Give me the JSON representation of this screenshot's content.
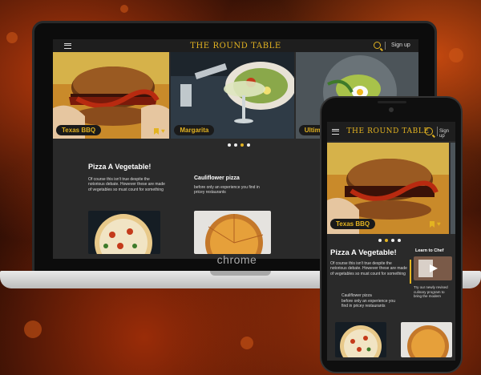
{
  "brand": "THE ROUND TABLE",
  "nav": {
    "signup": "Sign up"
  },
  "laptop": {
    "chrome_label": "chrome",
    "slides": [
      {
        "label": "Texas BBQ"
      },
      {
        "label": "Margarita"
      },
      {
        "label": "Ultim"
      }
    ],
    "article": {
      "title": "Pizza A Vegetable!",
      "body": "Of course this isn't true despite the notorious debate. However these are made of vegetables so must count for something"
    },
    "side": {
      "title": "Cauliflower pizza",
      "body": "before only an experience you find in pricey restaurants"
    }
  },
  "phone": {
    "slide_label": "Texas BBQ",
    "article": {
      "title": "Pizza A Vegetable!",
      "body": "Of course this isn't true despite the notorious debate. However these are made of vegetables so must count for something"
    },
    "side": {
      "title": "Cauliflower pizza",
      "body": "before only an experience you find in pricey restaurants"
    },
    "learn": {
      "title": "Learn to Chef",
      "body": "Try our newly revised culinary program to bring the modern"
    }
  },
  "colors": {
    "accent": "#e3b321",
    "panel": "#2a2a2a",
    "nav": "#1e1e1e"
  }
}
